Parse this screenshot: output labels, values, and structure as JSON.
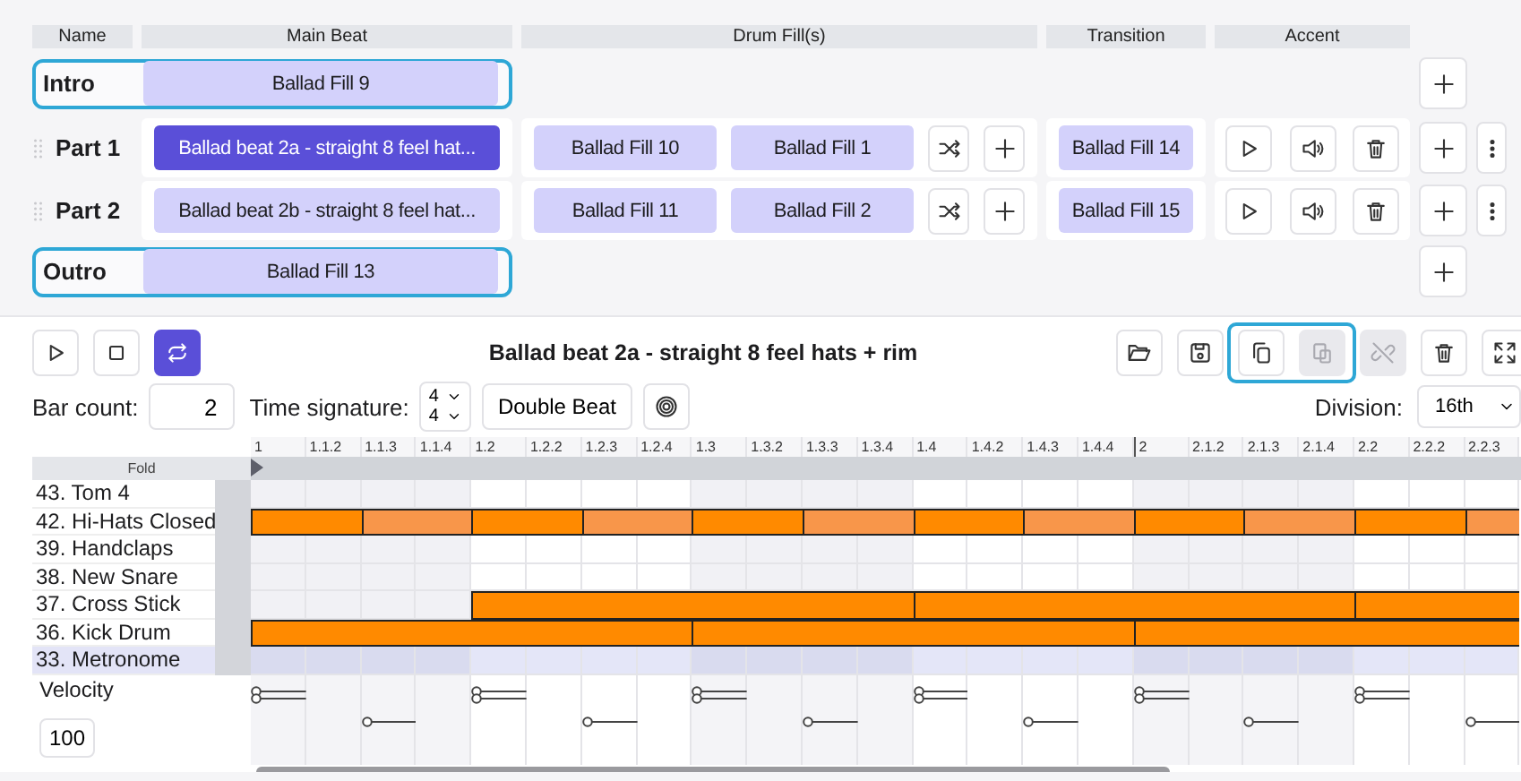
{
  "columns": [
    {
      "label": "Name"
    },
    {
      "label": "Main Beat"
    },
    {
      "label": "Drum Fill(s)"
    },
    {
      "label": "Transition"
    },
    {
      "label": "Accent"
    }
  ],
  "sections": [
    {
      "name": "Intro",
      "kind": "fixed",
      "main_beat": {
        "label": "Ballad Fill 9",
        "selected": false
      }
    },
    {
      "name": "Part 1",
      "kind": "part",
      "main_beat": {
        "label": "Ballad beat 2a - straight 8 feel hat...",
        "selected": true
      },
      "fills": [
        {
          "label": "Ballad Fill 10"
        },
        {
          "label": "Ballad Fill 1"
        }
      ],
      "transition": "Ballad Fill 14"
    },
    {
      "name": "Part 2",
      "kind": "part",
      "main_beat": {
        "label": "Ballad beat 2b - straight 8 feel hat...",
        "selected": false
      },
      "fills": [
        {
          "label": "Ballad Fill 11"
        },
        {
          "label": "Ballad Fill 2"
        }
      ],
      "transition": "Ballad Fill 15"
    },
    {
      "name": "Outro",
      "kind": "fixed",
      "main_beat": {
        "label": "Ballad Fill 13",
        "selected": false
      }
    }
  ],
  "editor": {
    "transport": [
      {
        "kind": "play",
        "on": false
      },
      {
        "kind": "stop",
        "on": false
      },
      {
        "kind": "loop",
        "on": true
      }
    ],
    "title": "Ballad beat 2a - straight 8 feel hats + rim",
    "actions": [
      {
        "kind": "open",
        "disabled": false
      },
      {
        "kind": "save",
        "disabled": false
      },
      {
        "kind": "group",
        "focused": true,
        "items": [
          {
            "kind": "copy",
            "disabled": false
          },
          {
            "kind": "paste",
            "disabled": true
          }
        ]
      },
      {
        "kind": "unlink",
        "disabled": true
      },
      {
        "kind": "delete",
        "disabled": false
      },
      {
        "kind": "fullscreen",
        "disabled": false
      }
    ],
    "bar_count_label": "Bar count:",
    "bar_count": "2",
    "time_signature_label": "Time signature:",
    "time_signature": {
      "numerator": "4",
      "denominator": "4"
    },
    "double_beat": "Double Beat",
    "division_label": "Division:",
    "division": "16th"
  },
  "grid": {
    "fold": "Fold",
    "ruler": [
      "1",
      "1.1.2",
      "1.1.3",
      "1.1.4",
      "1.2",
      "1.2.2",
      "1.2.3",
      "1.2.4",
      "1.3",
      "1.3.2",
      "1.3.3",
      "1.3.4",
      "1.4",
      "1.4.2",
      "1.4.3",
      "1.4.4",
      "2",
      "2.1.2",
      "2.1.3",
      "2.1.4",
      "2.2",
      "2.2.2",
      "2.2.3"
    ],
    "tracks": [
      {
        "name": "43. Tom 4",
        "selected": false
      },
      {
        "name": "42. Hi-Hats Closed",
        "selected": false,
        "cells": [
          {
            "kind": "start",
            "accent": true
          },
          {
            "kind": "hold"
          },
          {
            "kind": "start",
            "accent": false
          },
          {
            "kind": "hold"
          },
          {
            "kind": "start",
            "accent": true
          },
          {
            "kind": "hold"
          },
          {
            "kind": "start",
            "accent": false
          },
          {
            "kind": "hold"
          },
          {
            "kind": "start",
            "accent": true
          },
          {
            "kind": "hold"
          },
          {
            "kind": "start",
            "accent": false
          },
          {
            "kind": "hold"
          },
          {
            "kind": "start",
            "accent": true
          },
          {
            "kind": "hold"
          },
          {
            "kind": "start",
            "accent": false
          },
          {
            "kind": "hold"
          },
          {
            "kind": "start",
            "accent": true
          },
          {
            "kind": "hold"
          },
          {
            "kind": "start",
            "accent": false
          },
          {
            "kind": "hold"
          },
          {
            "kind": "start",
            "accent": true
          },
          {
            "kind": "hold"
          },
          {
            "kind": "start",
            "accent": false
          }
        ]
      },
      {
        "name": "39. Handclaps",
        "selected": false
      },
      {
        "name": "38. New Snare",
        "selected": false
      },
      {
        "name": "37. Cross Stick",
        "selected": false,
        "cells": [
          {
            "kind": "rest"
          },
          {
            "kind": "rest"
          },
          {
            "kind": "rest"
          },
          {
            "kind": "rest"
          },
          {
            "kind": "start",
            "accent": true
          },
          {
            "kind": "hold"
          },
          {
            "kind": "hold"
          },
          {
            "kind": "hold"
          },
          {
            "kind": "hold"
          },
          {
            "kind": "hold"
          },
          {
            "kind": "hold"
          },
          {
            "kind": "hold"
          },
          {
            "kind": "start",
            "accent": true
          },
          {
            "kind": "hold"
          },
          {
            "kind": "hold"
          },
          {
            "kind": "hold"
          },
          {
            "kind": "hold"
          },
          {
            "kind": "hold"
          },
          {
            "kind": "hold"
          },
          {
            "kind": "hold"
          },
          {
            "kind": "start",
            "accent": true
          },
          {
            "kind": "hold"
          },
          {
            "kind": "hold"
          }
        ]
      },
      {
        "name": "36. Kick Drum",
        "selected": false,
        "cells": [
          {
            "kind": "start",
            "accent": true
          },
          {
            "kind": "hold"
          },
          {
            "kind": "hold"
          },
          {
            "kind": "hold"
          },
          {
            "kind": "hold"
          },
          {
            "kind": "hold"
          },
          {
            "kind": "hold"
          },
          {
            "kind": "hold"
          },
          {
            "kind": "start",
            "accent": true
          },
          {
            "kind": "hold"
          },
          {
            "kind": "hold"
          },
          {
            "kind": "hold"
          },
          {
            "kind": "hold"
          },
          {
            "kind": "hold"
          },
          {
            "kind": "hold"
          },
          {
            "kind": "hold"
          },
          {
            "kind": "start",
            "accent": true
          },
          {
            "kind": "hold"
          },
          {
            "kind": "hold"
          },
          {
            "kind": "hold"
          },
          {
            "kind": "hold"
          },
          {
            "kind": "hold"
          },
          {
            "kind": "hold"
          }
        ]
      },
      {
        "name": "33. Metronome",
        "selected": true
      }
    ],
    "velocity_label": "Velocity",
    "velocity_value": "100"
  }
}
